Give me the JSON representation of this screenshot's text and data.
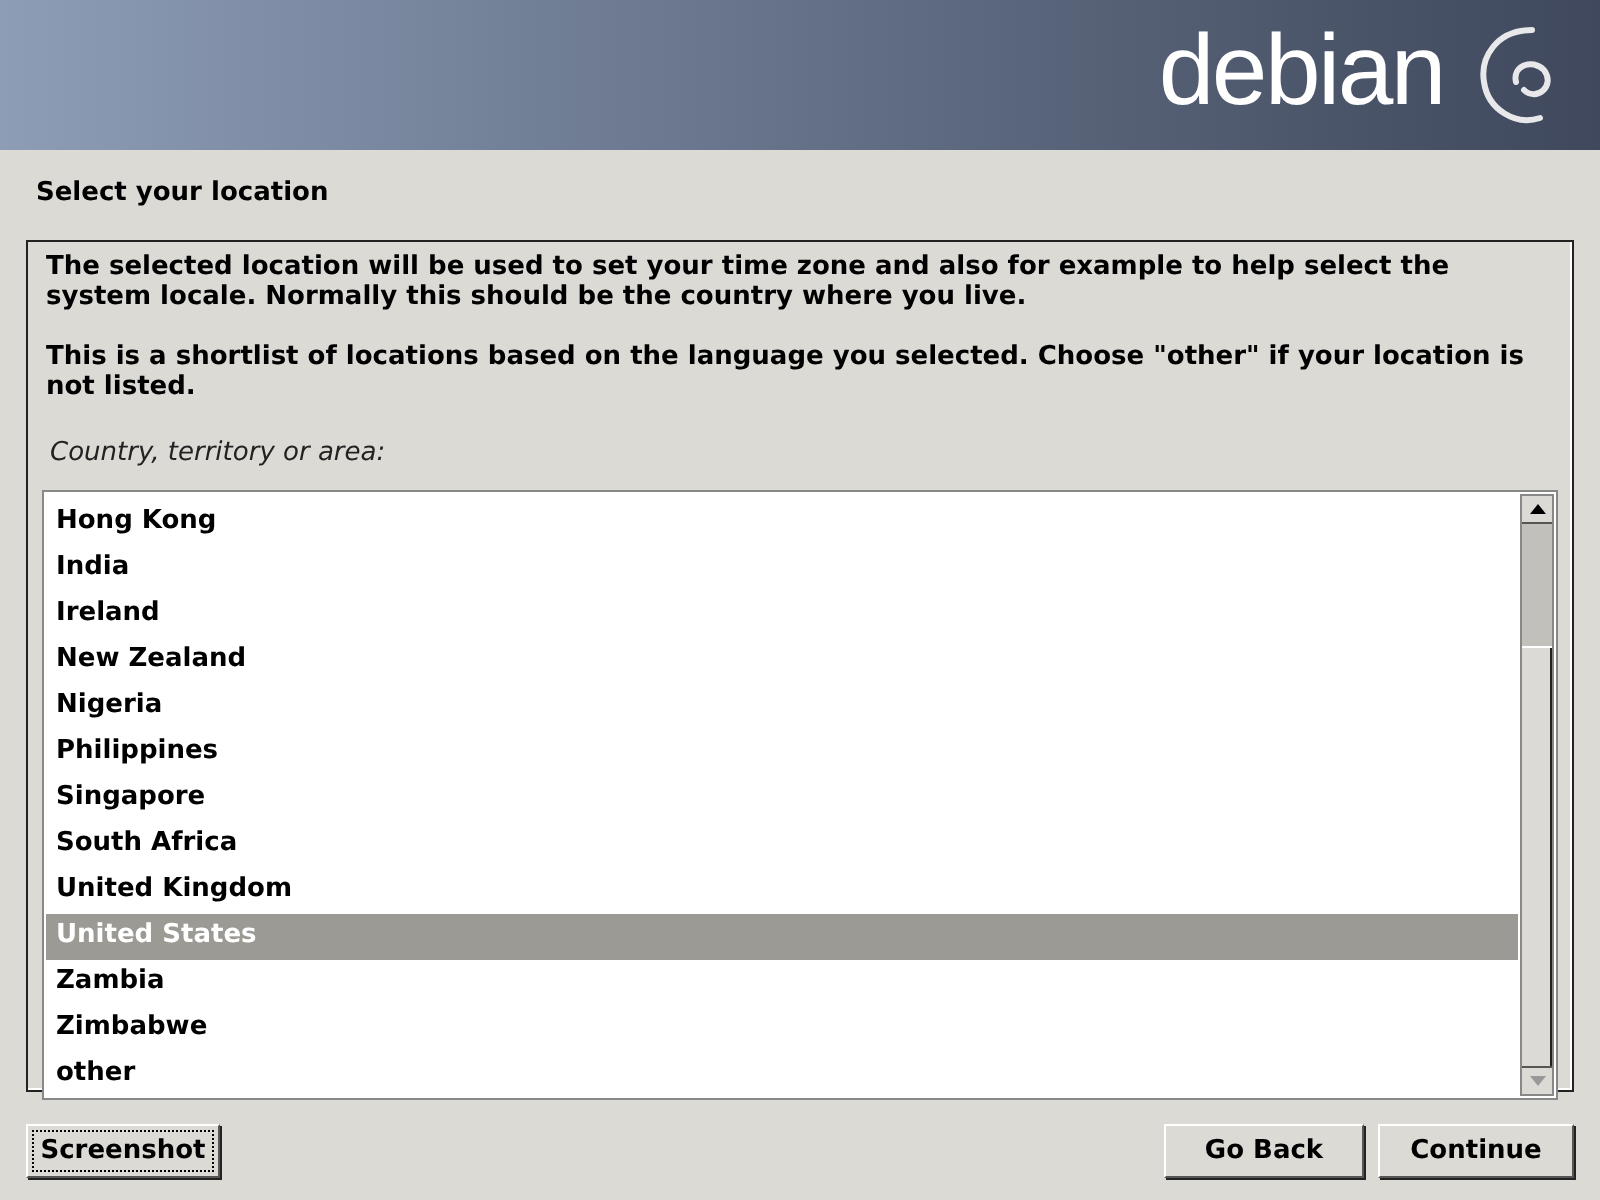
{
  "header": {
    "logo_text": "debian"
  },
  "title": "Select your location",
  "description": [
    "The selected location will be used to set your time zone and also for example to help select the system locale. Normally this should be the country where you live.",
    "This is a shortlist of locations based on the language you selected. Choose \"other\" if your location is not listed."
  ],
  "list_label": "Country, territory or area:",
  "items": [
    {
      "label": "Hong Kong",
      "selected": false
    },
    {
      "label": "India",
      "selected": false
    },
    {
      "label": "Ireland",
      "selected": false
    },
    {
      "label": "New Zealand",
      "selected": false
    },
    {
      "label": "Nigeria",
      "selected": false
    },
    {
      "label": "Philippines",
      "selected": false
    },
    {
      "label": "Singapore",
      "selected": false
    },
    {
      "label": "South Africa",
      "selected": false
    },
    {
      "label": "United Kingdom",
      "selected": false
    },
    {
      "label": "United States",
      "selected": true
    },
    {
      "label": "Zambia",
      "selected": false
    },
    {
      "label": "Zimbabwe",
      "selected": false
    },
    {
      "label": "other",
      "selected": false
    }
  ],
  "buttons": {
    "screenshot": "Screenshot",
    "back": "Go Back",
    "continue": "Continue"
  }
}
